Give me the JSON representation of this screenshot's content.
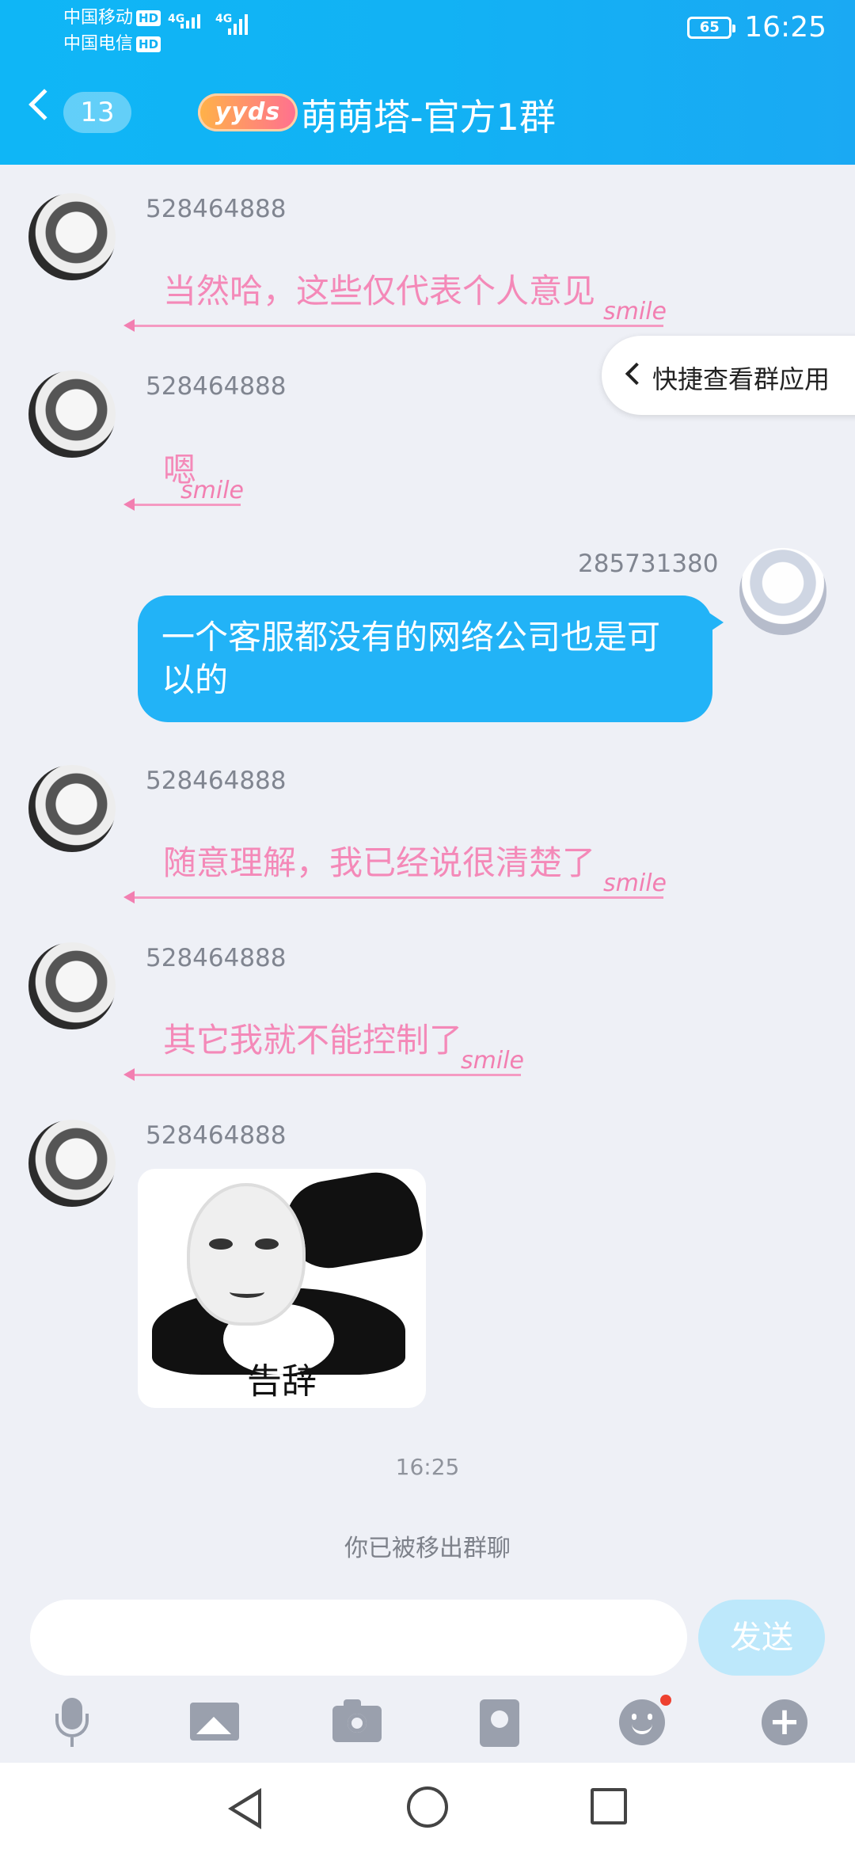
{
  "status_bar": {
    "carrier1": "中国移动",
    "carrier2": "中国电信",
    "hd": "HD",
    "net": "4G",
    "battery": "65",
    "time": "16:25"
  },
  "header": {
    "unread_count": "13",
    "badge": "yyds",
    "title": "萌萌塔-官方1群"
  },
  "shortcut": {
    "label": "快捷查看群应用"
  },
  "messages": [
    {
      "sender": "528464888",
      "text": "当然哈，这些仅代表个人意见"
    },
    {
      "sender": "528464888",
      "text": "嗯"
    },
    {
      "sender": "285731380",
      "text": "一个客服都没有的网络公司也是可以的"
    },
    {
      "sender": "528464888",
      "text": "随意理解，我已经说很清楚了"
    },
    {
      "sender": "528464888",
      "text": "其它我就不能控制了"
    },
    {
      "sender": "528464888",
      "sticker_caption": "告辞"
    }
  ],
  "timestamp": "16:25",
  "system_notice": "你已被移出群聊",
  "input": {
    "placeholder": "",
    "send_label": "发送"
  },
  "bubble_decor": "smile"
}
